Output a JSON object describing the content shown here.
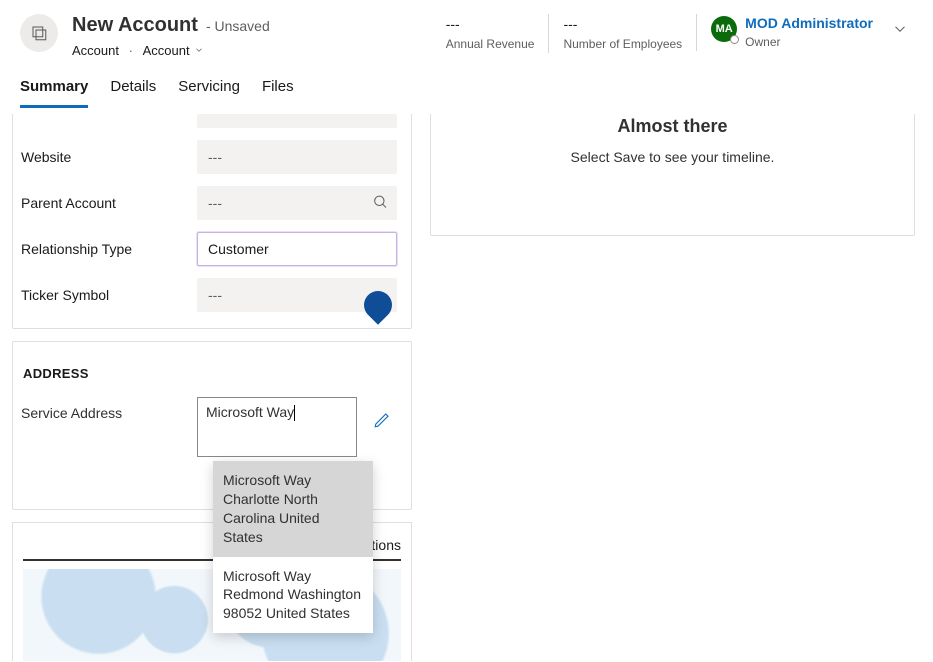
{
  "header": {
    "title": "New Account",
    "unsaved_suffix": "- Unsaved",
    "breadcrumb_entity": "Account",
    "breadcrumb_form": "Account",
    "annual_revenue_value": "---",
    "annual_revenue_label": "Annual Revenue",
    "employees_value": "---",
    "employees_label": "Number of Employees",
    "owner_initials": "MA",
    "owner_name": "MOD Administrator",
    "owner_label": "Owner"
  },
  "tabs": {
    "summary": "Summary",
    "details": "Details",
    "servicing": "Servicing",
    "files": "Files"
  },
  "fields": {
    "website_label": "Website",
    "website_value": "---",
    "parent_label": "Parent Account",
    "parent_value": "---",
    "reltype_label": "Relationship Type",
    "reltype_value": "Customer",
    "ticker_label": "Ticker Symbol",
    "ticker_value": "---"
  },
  "address": {
    "section_title": "ADDRESS",
    "service_label": "Service Address",
    "input_value": "Microsoft Way",
    "suggestions": [
      "Microsoft Way Charlotte North Carolina United States",
      "Microsoft Way Redmond Washington 98052 United States"
    ]
  },
  "map": {
    "tab_label": "ctions"
  },
  "timeline": {
    "heading": "Almost there",
    "body": "Select Save to see your timeline."
  }
}
